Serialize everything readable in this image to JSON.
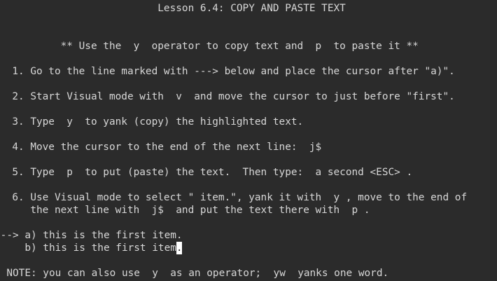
{
  "terminal": {
    "title": "                          Lesson 6.4: COPY AND PASTE TEXT",
    "intro": "          ** Use the  y  operator to copy text and  p  to paste it **",
    "steps": [
      "  1. Go to the line marked with ---> below and place the cursor after \"a)\".",
      "  2. Start Visual mode with  v  and move the cursor to just before \"first\".",
      "  3. Type  y  to yank (copy) the highlighted text.",
      "  4. Move the cursor to the end of the next line:  j$",
      "  5. Type  p  to put (paste) the text.  Then type:  a second <ESC> .",
      "  6. Use Visual mode to select \" item.\", yank it with  y , move to the end of",
      "     the next line with  j$  and put the text there with  p ."
    ],
    "example_lines": [
      "---> a) this is the first item.",
      "     b) this is the first item"
    ],
    "cursor_char": ".",
    "note": "  NOTE: you can also use  y  as an operator;  yw  yanks one word."
  },
  "colors": {
    "background": "#2b2b2b",
    "text": "#d7d7d7",
    "cursor": "#ffffff"
  }
}
